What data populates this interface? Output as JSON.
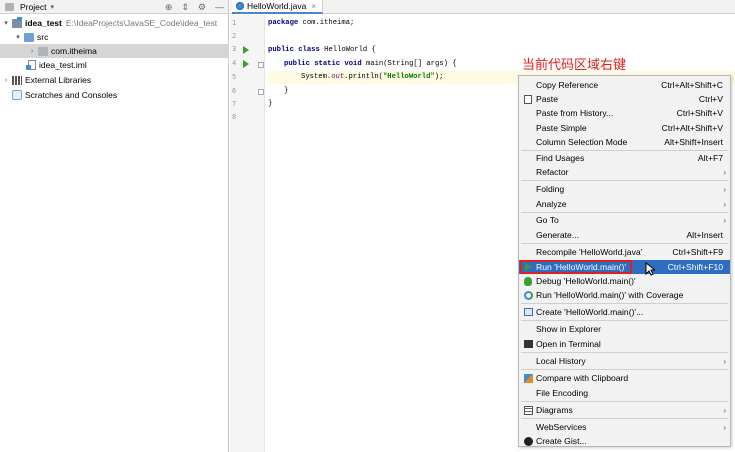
{
  "project_panel": {
    "title": "Project",
    "tree": [
      {
        "label": "idea_test",
        "path": "E:\\IdeaProjects\\JavaSE_Code\\idea_test"
      },
      {
        "label": "src"
      },
      {
        "label": "com.itheima"
      },
      {
        "label": "idea_test.iml"
      },
      {
        "label": "External Libraries"
      },
      {
        "label": "Scratches and Consoles"
      }
    ]
  },
  "editor": {
    "tab_label": "HelloWorld.java",
    "line_numbers": [
      "1",
      "2",
      "3",
      "4",
      "5",
      "6",
      "7",
      "8"
    ],
    "code": {
      "l1_kw": "package",
      "l1_rest": " com.itheima;",
      "l3_kw": "public class",
      "l3_rest": " HelloWorld {",
      "l4_kw": "public static void",
      "l4_rest": " main(String[] args) {",
      "l5_a": "System.",
      "l5_fld": "out",
      "l5_b": ".println(",
      "l5_str": "\"HelloWorld\"",
      "l5_c": ");",
      "l6": "}",
      "l7": "}"
    }
  },
  "annotation": "当前代码区域右键",
  "context_menu": {
    "items": [
      {
        "label": "Copy Reference",
        "shortcut": "Ctrl+Alt+Shift+C"
      },
      {
        "label": "Paste",
        "shortcut": "Ctrl+V",
        "icon": "paste-icon"
      },
      {
        "label": "Paste from History...",
        "shortcut": "Ctrl+Shift+V"
      },
      {
        "label": "Paste Simple",
        "shortcut": "Ctrl+Alt+Shift+V"
      },
      {
        "label": "Column Selection Mode",
        "shortcut": "Alt+Shift+Insert"
      },
      {
        "label": "Find Usages",
        "shortcut": "Alt+F7"
      },
      {
        "label": "Refactor",
        "submenu": true
      },
      {
        "label": "Folding",
        "submenu": true
      },
      {
        "label": "Analyze",
        "submenu": true
      },
      {
        "label": "Go To",
        "submenu": true
      },
      {
        "label": "Generate...",
        "shortcut": "Alt+Insert"
      },
      {
        "label": "Recompile 'HelloWorld.java'",
        "shortcut": "Ctrl+Shift+F9"
      },
      {
        "label": "Run 'HelloWorld.main()'",
        "shortcut": "Ctrl+Shift+F10",
        "icon": "run-icon"
      },
      {
        "label": "Debug 'HelloWorld.main()'",
        "icon": "debug-icon"
      },
      {
        "label": "Run 'HelloWorld.main()' with Coverage",
        "icon": "coverage-icon"
      },
      {
        "label": "Create 'HelloWorld.main()'...",
        "icon": "create-config-icon"
      },
      {
        "label": "Show in Explorer"
      },
      {
        "label": "Open in Terminal",
        "icon": "terminal-icon"
      },
      {
        "label": "Local History",
        "submenu": true
      },
      {
        "label": "Compare with Clipboard",
        "icon": "compare-icon"
      },
      {
        "label": "File Encoding"
      },
      {
        "label": "Diagrams",
        "submenu": true,
        "icon": "diagram-icon"
      },
      {
        "label": "WebServices",
        "submenu": true
      },
      {
        "label": "Create Gist...",
        "icon": "github-icon"
      }
    ]
  },
  "colors": {
    "highlight": "#2e6dc1",
    "annotation": "#e0201a",
    "run_green": "#39a02f"
  }
}
